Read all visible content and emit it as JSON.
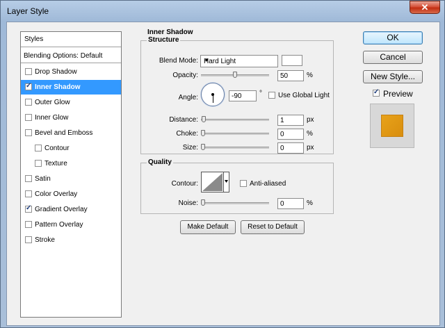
{
  "window": {
    "title": "Layer Style",
    "close_glyph": "✕"
  },
  "styles_list": {
    "header": "Styles",
    "blending": "Blending Options: Default",
    "items": [
      {
        "label": "Drop Shadow",
        "checked": false,
        "selected": false,
        "indent": false
      },
      {
        "label": "Inner Shadow",
        "checked": true,
        "selected": true,
        "indent": false
      },
      {
        "label": "Outer Glow",
        "checked": false,
        "selected": false,
        "indent": false
      },
      {
        "label": "Inner Glow",
        "checked": false,
        "selected": false,
        "indent": false
      },
      {
        "label": "Bevel and Emboss",
        "checked": false,
        "selected": false,
        "indent": false
      },
      {
        "label": "Contour",
        "checked": false,
        "selected": false,
        "indent": true
      },
      {
        "label": "Texture",
        "checked": false,
        "selected": false,
        "indent": true
      },
      {
        "label": "Satin",
        "checked": false,
        "selected": false,
        "indent": false
      },
      {
        "label": "Color Overlay",
        "checked": false,
        "selected": false,
        "indent": false
      },
      {
        "label": "Gradient Overlay",
        "checked": true,
        "selected": false,
        "indent": false
      },
      {
        "label": "Pattern Overlay",
        "checked": false,
        "selected": false,
        "indent": false
      },
      {
        "label": "Stroke",
        "checked": false,
        "selected": false,
        "indent": false
      }
    ]
  },
  "inner_shadow": {
    "section_title": "Inner Shadow",
    "structure": {
      "title": "Structure",
      "blend_mode_label": "Blend Mode:",
      "blend_mode_value": "Hard Light",
      "opacity_label": "Opacity:",
      "opacity_value": "50",
      "opacity_unit": "%",
      "opacity_fraction": 0.5,
      "angle_label": "Angle:",
      "angle_value": "-90",
      "angle_unit": "°",
      "use_global_light_label": "Use Global Light",
      "use_global_light_checked": false,
      "distance_label": "Distance:",
      "distance_value": "1",
      "distance_unit": "px",
      "choke_label": "Choke:",
      "choke_value": "0",
      "choke_unit": "%",
      "size_label": "Size:",
      "size_value": "0",
      "size_unit": "px"
    },
    "quality": {
      "title": "Quality",
      "contour_label": "Contour:",
      "anti_aliased_label": "Anti-aliased",
      "anti_aliased_checked": false,
      "noise_label": "Noise:",
      "noise_value": "0",
      "noise_unit": "%"
    },
    "make_default_label": "Make Default",
    "reset_default_label": "Reset to Default"
  },
  "actions": {
    "ok_label": "OK",
    "cancel_label": "Cancel",
    "new_style_label": "New Style...",
    "preview_label": "Preview",
    "preview_checked": true
  },
  "colors": {
    "selection": "#3399ff",
    "preview_fill": "#e09a16"
  }
}
